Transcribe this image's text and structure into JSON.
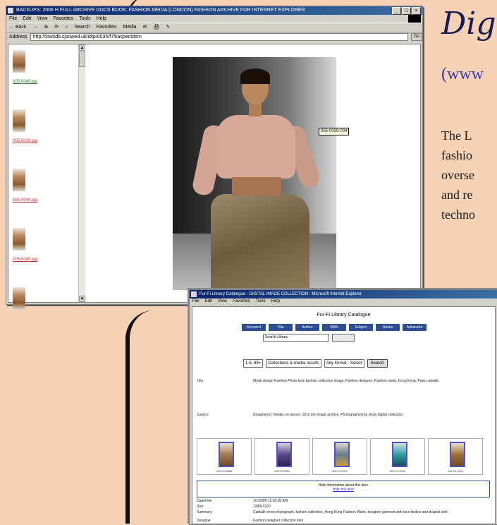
{
  "slide": {
    "title": "Dig",
    "url": "(www",
    "body_lines": [
      "The L",
      "fashio",
      "overse",
      "and re",
      "techno"
    ]
  },
  "browser1": {
    "title": "BACKUPS: 2006 H FULL ARCHIVE DOCS BOOK: FASHION MEDIA (LONDON) FASHION ARCHIVE FOR INTERNET EXPLORER",
    "controls": [
      "_",
      "□",
      "×"
    ],
    "menu": [
      "File",
      "Edit",
      "View",
      "Favorites",
      "Tools",
      "Help"
    ],
    "toolbar": [
      "← Back",
      "→",
      "⊗",
      "⟳",
      "⌂",
      "Search",
      "Favorites",
      "Media",
      "✉",
      "🖨",
      "✎"
    ],
    "address_label": "Address",
    "address_value": "http://lowsdb.cjsowed.uk/idtp/0035/f7/kaspectdom",
    "go_label": "Go",
    "thumbnails": [
      {
        "link": "005-0040.jpg",
        "color": "#2a7a2a"
      },
      {
        "link": "005-0039.jpg",
        "color": "#c03030"
      },
      {
        "link": "005-0040.jpg",
        "color": "#c03030"
      },
      {
        "link": "005-0049.jpg",
        "color": "#c03030"
      }
    ],
    "tooltip": "005-0039-004"
  },
  "browser2": {
    "title": "Fur-Fi Library Catalogue - DIGITAL IMAGE COLLECTION - Microsoft Internet Explorer",
    "menu": [
      "File",
      "Edit",
      "View",
      "Favorites",
      "Tools",
      "Help"
    ],
    "library_title": "Fur-Fi Library Catalogue",
    "nav": [
      "Keyword",
      "Title",
      "Author",
      "ISBN",
      "Subject",
      "Series",
      "Advanced"
    ],
    "search_value": "Search Library",
    "form": {
      "count": "1-5, 99+",
      "scope": "Collections & media results",
      "sort": "Any format - Select",
      "search_button": "Search"
    },
    "meta": [
      {
        "label": "Title",
        "text": "Mode design Fashion Photo from fashion collection image; Fashion designer, Fashion week, Hong Kong, Paris catwalk."
      },
      {
        "label": "Subject",
        "text": "Designer(s); Details on pieces; 18 to the image archive. Photographed by show digital collection."
      }
    ],
    "thumbs": [
      "005 21 0088",
      "005 21 0090",
      "005 21 0091",
      "005 21 0093",
      "005 21 0094"
    ],
    "info_heading": "Hide information about this item",
    "info_link": "Hide this item",
    "fields": [
      {
        "k": "Date/time",
        "v": "1/1/2005 12:00:00 AM"
      },
      {
        "k": "Size",
        "v": "1280x1920"
      },
      {
        "k": "Summary",
        "v": "Catwalk show photograph, fashion collection, Hong Kong Fashion Week, designer garment with lace bodice and draped skirt."
      },
      {
        "k": "Designer",
        "v": "Fashion designer collection item"
      }
    ]
  }
}
